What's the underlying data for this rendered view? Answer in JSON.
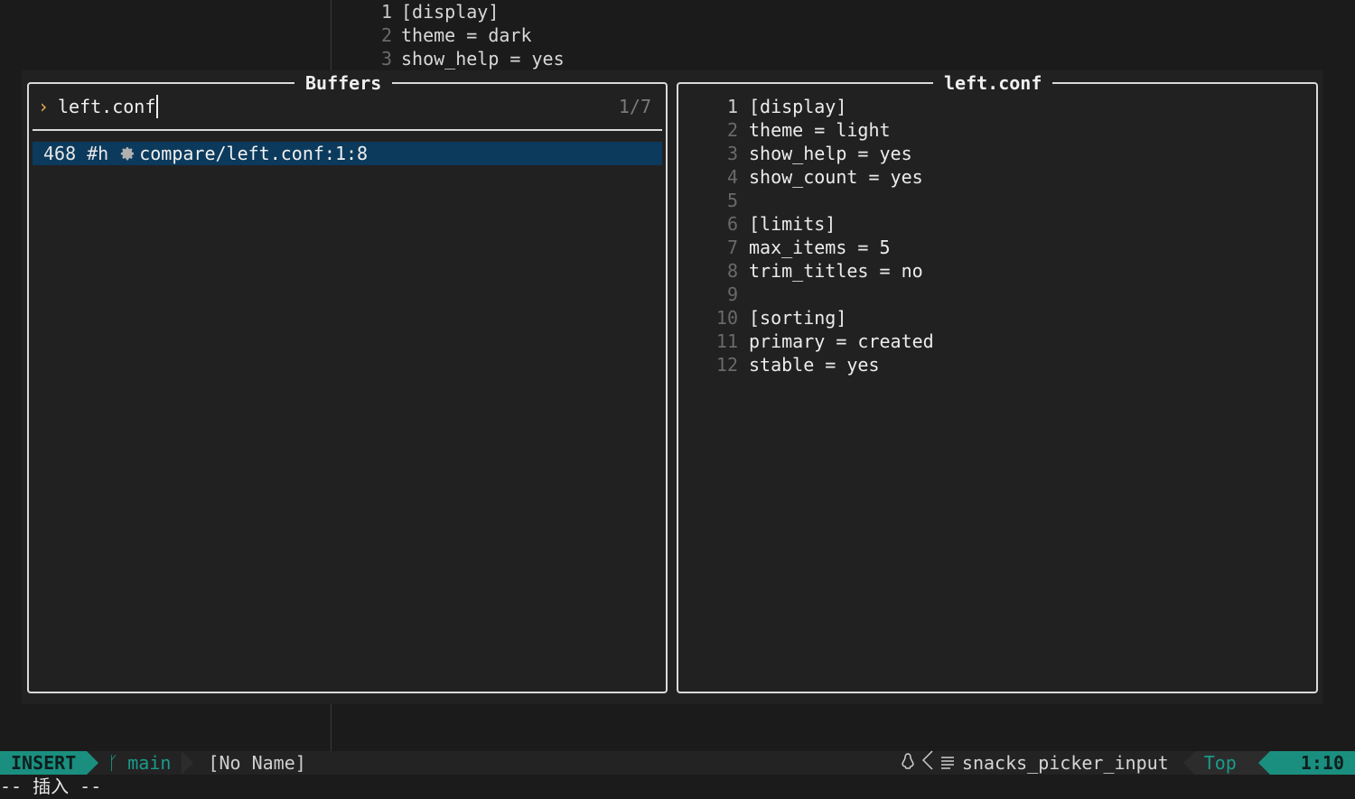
{
  "background_editor": {
    "lines": [
      {
        "num": "1",
        "text": "[display]"
      },
      {
        "num": "2",
        "text": "theme = dark"
      },
      {
        "num": "3",
        "text": "show_help = yes"
      }
    ]
  },
  "picker": {
    "list_title": "Buffers",
    "prompt_icon": "›",
    "query": "left.conf",
    "count": "1/7",
    "result": {
      "bufnr": "468",
      "flags": "#h",
      "icon": "gear-icon",
      "path": "compare/left.conf:1:8"
    },
    "preview_title": "left.conf",
    "preview_lines": [
      {
        "num": "1",
        "text": "[display]"
      },
      {
        "num": "2",
        "text": "theme = light"
      },
      {
        "num": "3",
        "text": "show_help = yes"
      },
      {
        "num": "4",
        "text": "show_count = yes"
      },
      {
        "num": "5",
        "text": ""
      },
      {
        "num": "6",
        "text": "[limits]"
      },
      {
        "num": "7",
        "text": "max_items = 5"
      },
      {
        "num": "8",
        "text": "trim_titles = no"
      },
      {
        "num": "9",
        "text": ""
      },
      {
        "num": "10",
        "text": "[sorting]"
      },
      {
        "num": "11",
        "text": "primary = created"
      },
      {
        "num": "12",
        "text": "stable = yes"
      }
    ]
  },
  "statusline": {
    "mode": "INSERT",
    "branch": "main",
    "filename": "[No Name]",
    "filetype": "snacks_picker_input",
    "position": "Top",
    "location": "1:10"
  },
  "cmdline": "-- 插入 --",
  "colors": {
    "accent": "#1a8f80",
    "selection": "#0b3a5c",
    "prompt": "#e6b450"
  }
}
